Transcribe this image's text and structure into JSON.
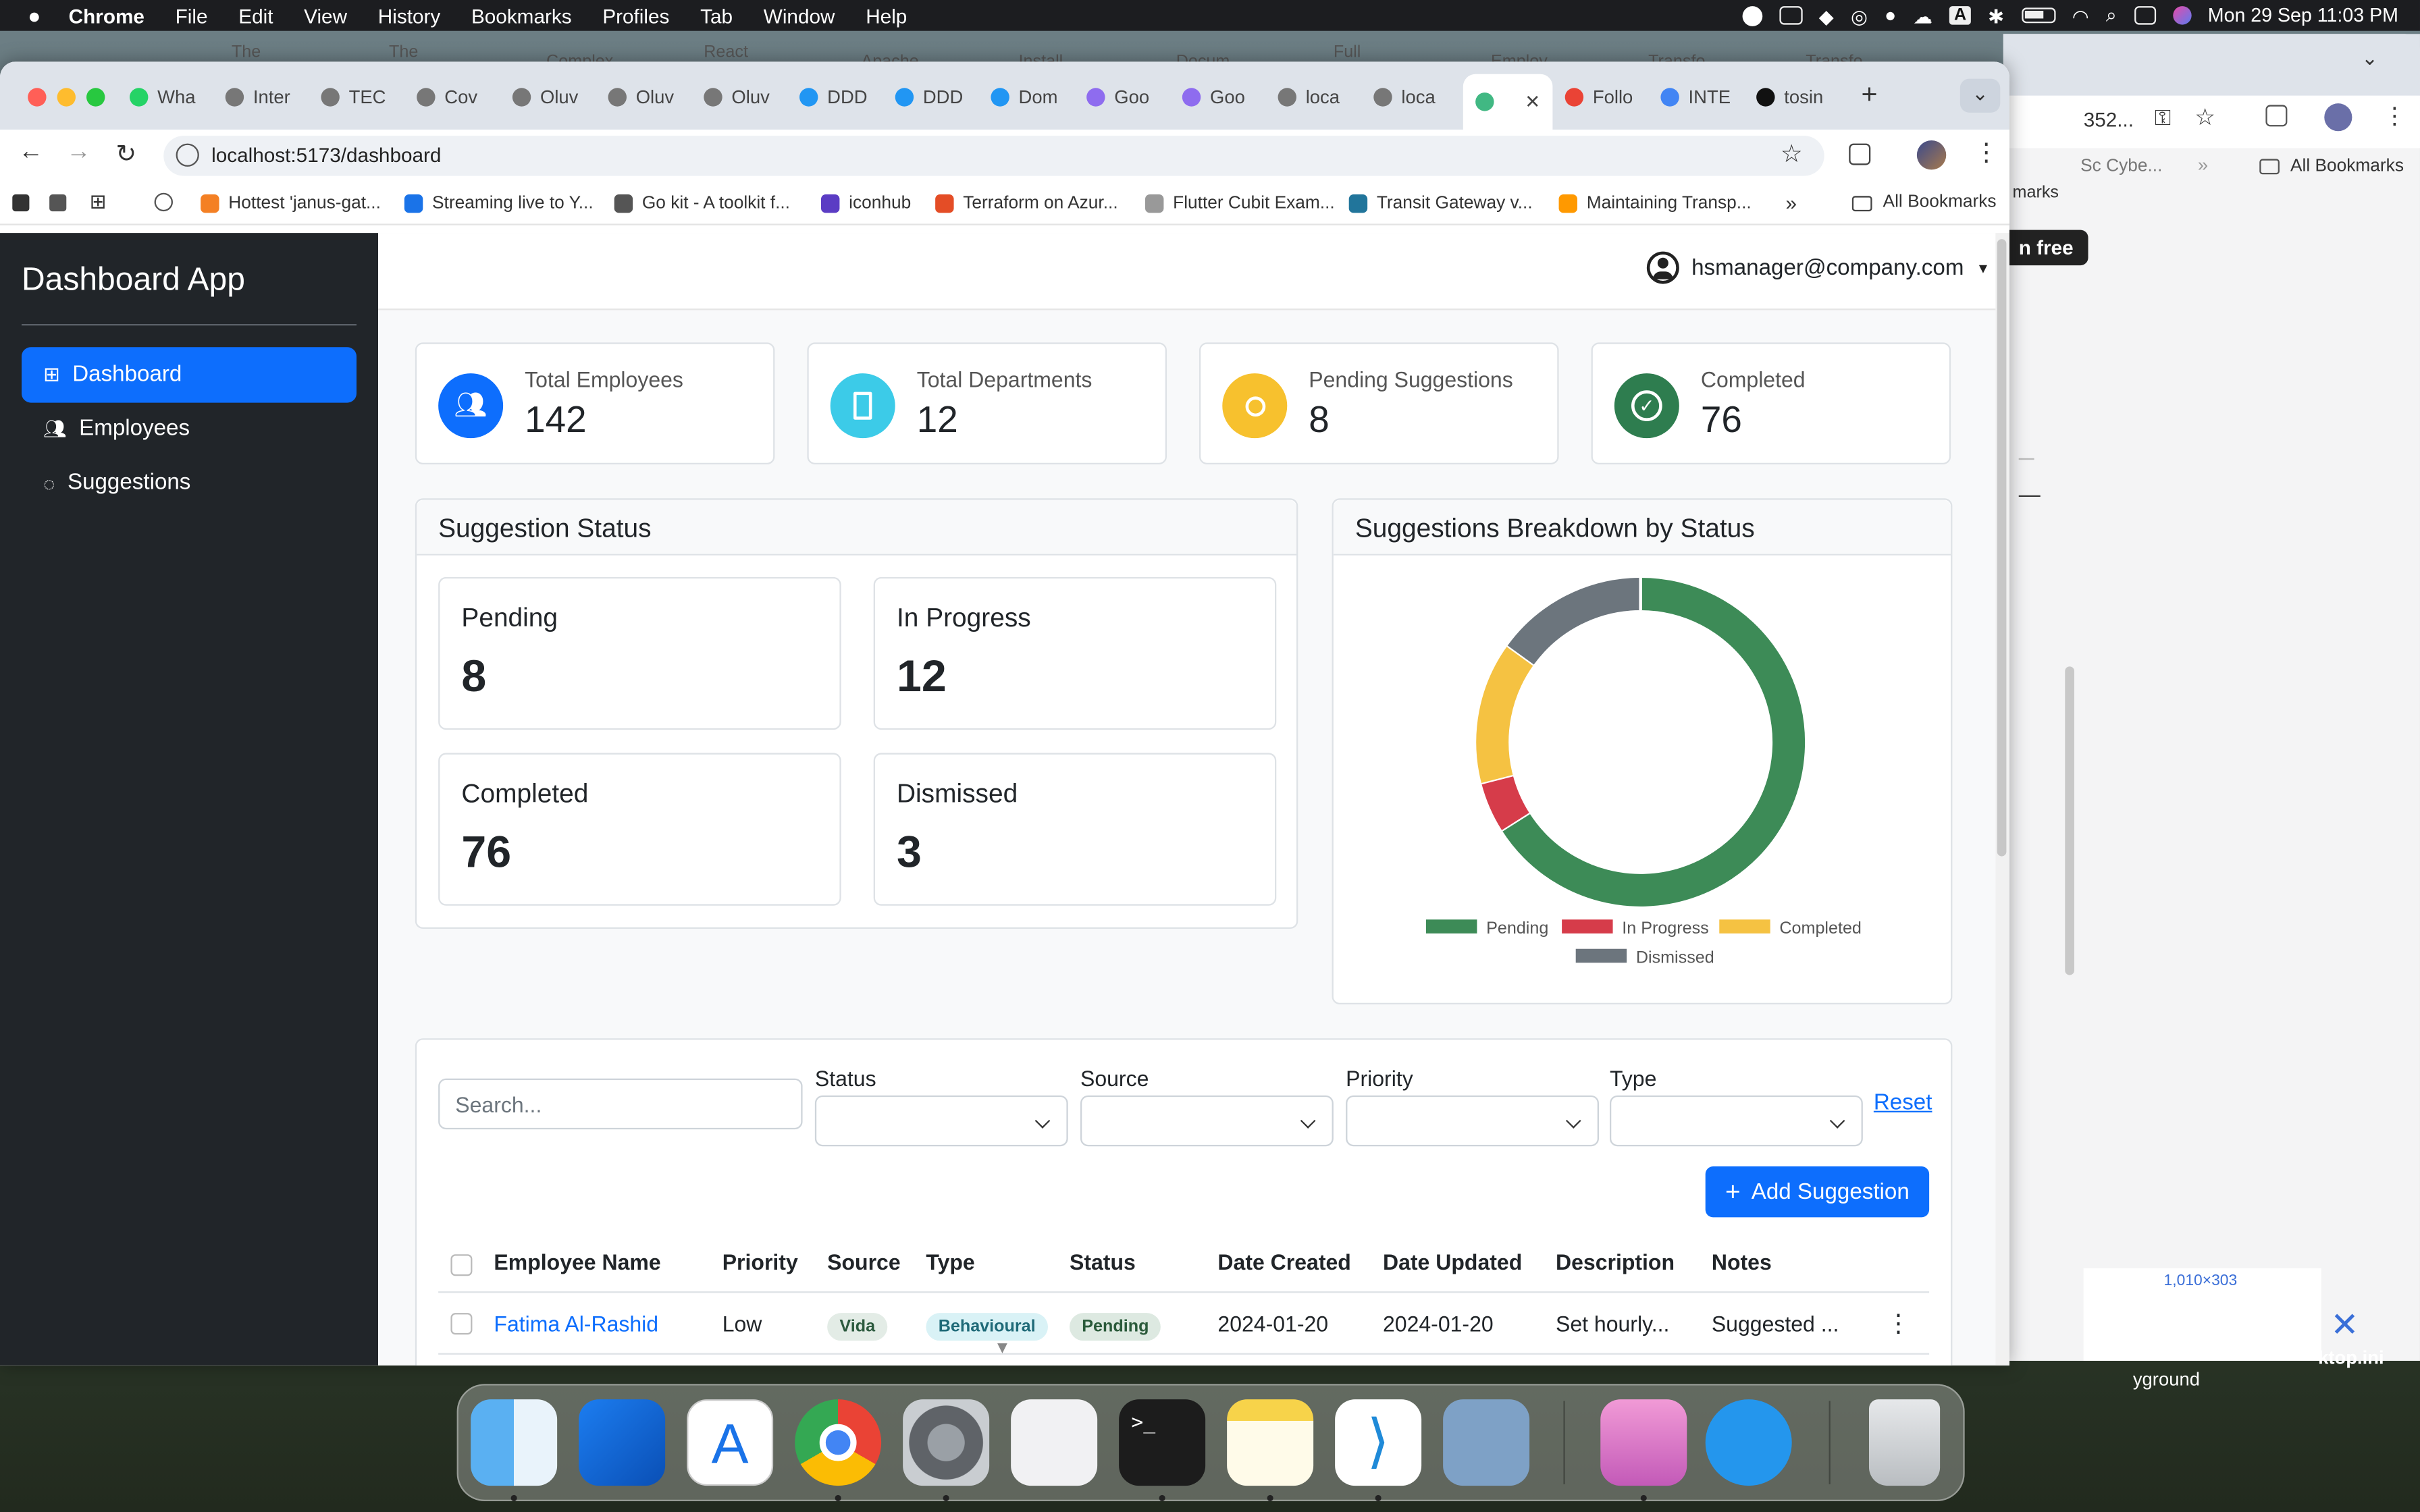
{
  "menubar": {
    "app": "Chrome",
    "items": [
      "File",
      "Edit",
      "View",
      "History",
      "Bookmarks",
      "Profiles",
      "Tab",
      "Window",
      "Help"
    ],
    "datetime": "Mon 29 Sep  11:03 PM",
    "a_indicator": "A"
  },
  "tabs": [
    {
      "label": "Wha",
      "color": "#25d366"
    },
    {
      "label": "Inter",
      "color": "#777"
    },
    {
      "label": "TEC",
      "color": "#777"
    },
    {
      "label": "Cov",
      "color": "#777"
    },
    {
      "label": "Oluv",
      "color": "#777"
    },
    {
      "label": "Oluv",
      "color": "#777"
    },
    {
      "label": "Oluv",
      "color": "#777"
    },
    {
      "label": "DDD",
      "color": "#2196f3"
    },
    {
      "label": "DDD",
      "color": "#2196f3"
    },
    {
      "label": "Dom",
      "color": "#2196f3"
    },
    {
      "label": "Goo",
      "color": "#8e6cef"
    },
    {
      "label": "Goo",
      "color": "#8e6cef"
    },
    {
      "label": "loca",
      "color": "#777"
    },
    {
      "label": "loca",
      "color": "#777"
    },
    {
      "label": "",
      "color": "#41b883",
      "active": true
    },
    {
      "label": "Follo",
      "color": "#ea4335"
    },
    {
      "label": "INTE",
      "color": "#4285f4"
    },
    {
      "label": "tosin",
      "color": "#111"
    }
  ],
  "background_tabs": [
    "The Co",
    "The Co",
    "Complex",
    "React N",
    "Apache",
    "Install",
    "Docum",
    "Full Sta",
    "Employ",
    "Transfo",
    "Transfo"
  ],
  "omnibox": {
    "url": "localhost:5173/dashboard"
  },
  "bookmarks": [
    {
      "label": "Hottest 'janus-gat...",
      "color": "#f48024"
    },
    {
      "label": "Streaming live to Y...",
      "color": "#1a73e8"
    },
    {
      "label": "Go kit - A toolkit f...",
      "color": "#555"
    },
    {
      "label": "iconhub",
      "color": "#5b3cc4"
    },
    {
      "label": "Terraform on Azur...",
      "color": "#e44d26"
    },
    {
      "label": "Flutter Cubit Exam...",
      "color": "#999"
    },
    {
      "label": "Transit Gateway v...",
      "color": "#21759b"
    },
    {
      "label": "Maintaining Transp...",
      "color": "#f90"
    }
  ],
  "all_bookmarks": "All Bookmarks",
  "back_window": {
    "tab_text": "352...",
    "bookmark": "Sc Cybe...",
    "all_bookmarks": "All Bookmarks",
    "marks": "marks",
    "free_btn": "n free",
    "dimension": "1,010×303",
    "file": "ktop.ini",
    "folder": "yground"
  },
  "app": {
    "brand": "Dashboard App",
    "nav": [
      {
        "label": "Dashboard",
        "active": true
      },
      {
        "label": "Employees"
      },
      {
        "label": "Suggestions"
      }
    ],
    "user": "hsmanager@company.com",
    "stats": [
      {
        "label": "Total Employees",
        "value": "142",
        "color": "#0d6efd"
      },
      {
        "label": "Total Departments",
        "value": "12",
        "color": "#0dcaf0"
      },
      {
        "label": "Pending Suggestions",
        "value": "8",
        "color": "#ffc107"
      },
      {
        "label": "Completed",
        "value": "76",
        "color": "#198754"
      }
    ],
    "status_card": {
      "title": "Suggestion Status",
      "items": [
        {
          "label": "Pending",
          "value": "8"
        },
        {
          "label": "In Progress",
          "value": "12"
        },
        {
          "label": "Completed",
          "value": "76"
        },
        {
          "label": "Dismissed",
          "value": "3"
        }
      ]
    },
    "breakdown_card": {
      "title": "Suggestions Breakdown by Status"
    },
    "filters": {
      "search_placeholder": "Search...",
      "status_label": "Status",
      "source_label": "Source",
      "priority_label": "Priority",
      "type_label": "Type",
      "reset": "Reset",
      "add_button": "Add Suggestion"
    },
    "table": {
      "headers": [
        "Employee Name",
        "Priority",
        "Source",
        "Type",
        "Status",
        "Date Created",
        "Date Updated",
        "Description",
        "Notes"
      ],
      "rows": [
        {
          "employee": "Fatima Al-Rashid",
          "priority": "Low",
          "source": "Vida",
          "type": "Behavioural",
          "status": "Pending",
          "created": "2024-01-20",
          "updated": "2024-01-20",
          "description": "Set hourly...",
          "notes": "Suggested ..."
        }
      ]
    }
  },
  "chart_data": {
    "type": "pie",
    "title": "Suggestions Breakdown by Status",
    "categories": [
      "Pending",
      "In Progress",
      "Completed",
      "Dismissed"
    ],
    "values": [
      66,
      5,
      14,
      15
    ],
    "colors": [
      "#3d8b57",
      "#d63c4a",
      "#f5c242",
      "#6c757d"
    ],
    "legend": "bottom"
  }
}
